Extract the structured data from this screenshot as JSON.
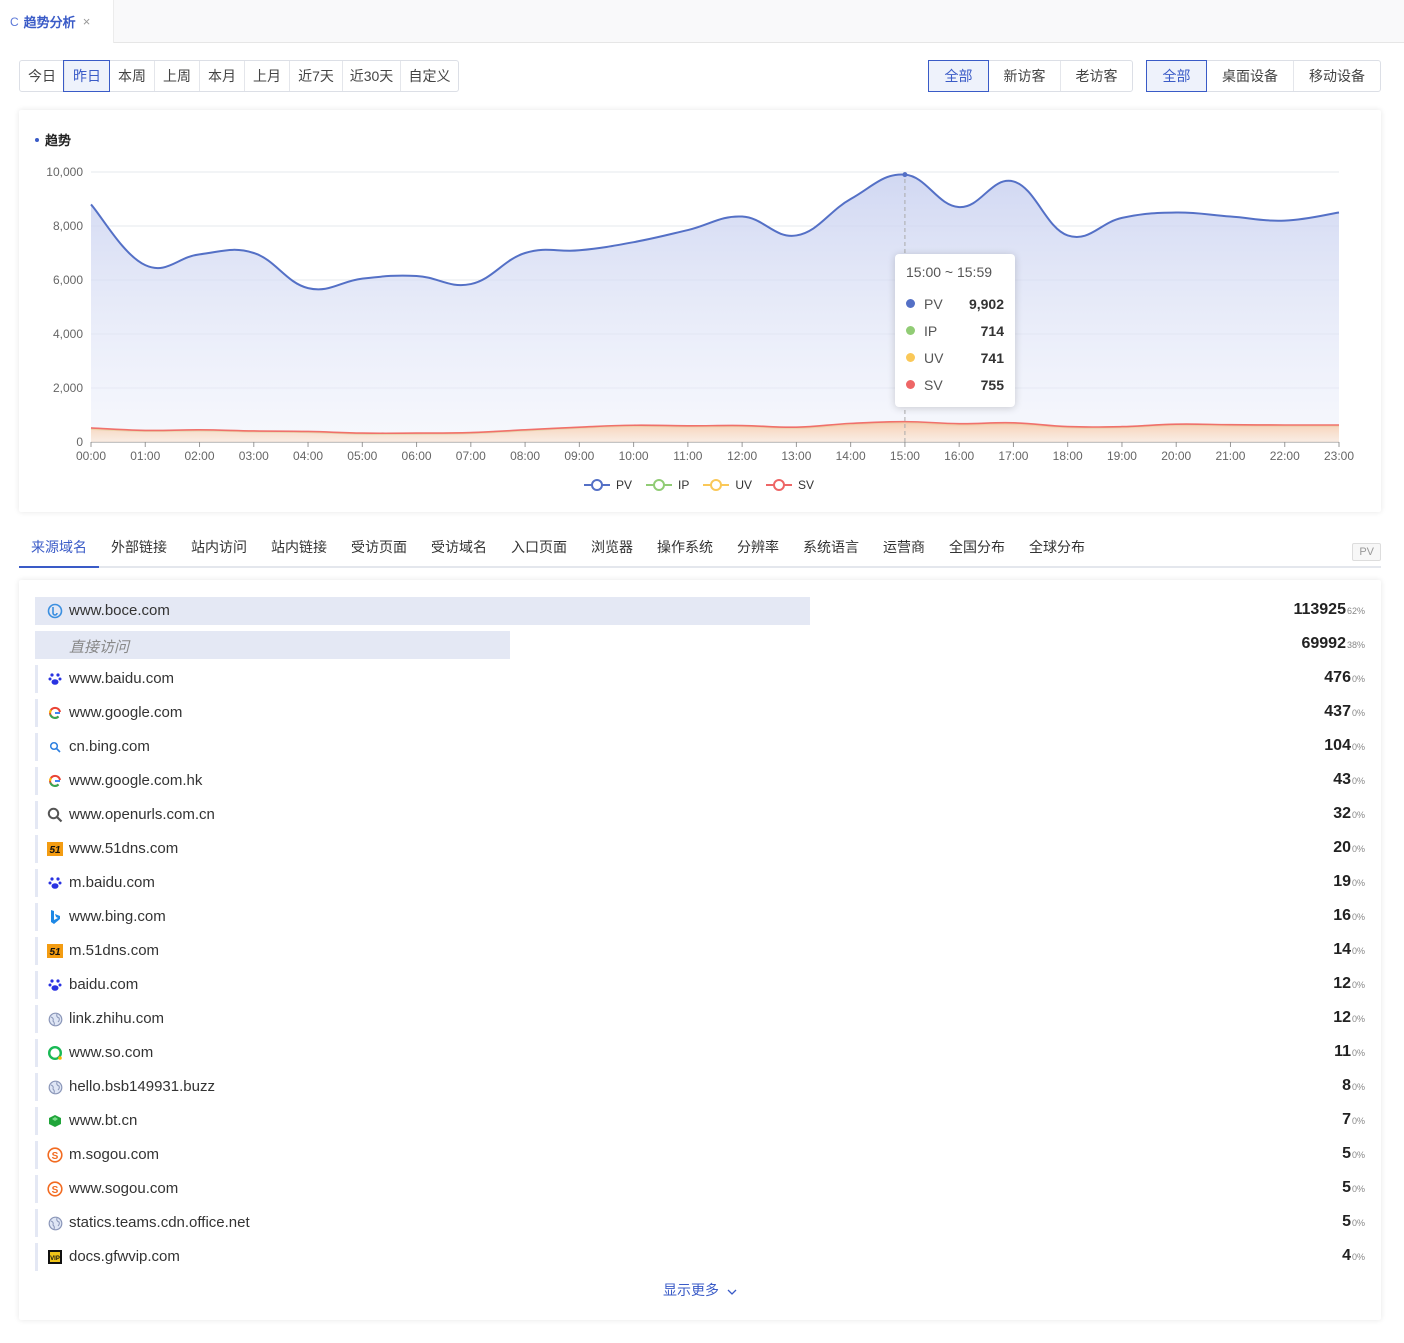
{
  "tab": {
    "title": "趋势分析",
    "reload_icon": "C",
    "close_icon": "×"
  },
  "date_range": {
    "options": [
      "今日",
      "昨日",
      "本周",
      "上周",
      "本月",
      "上月",
      "近7天",
      "近30天",
      "自定义"
    ],
    "selected": "昨日"
  },
  "visitor_filter": {
    "options": [
      "全部",
      "新访客",
      "老访客"
    ],
    "selected": "全部"
  },
  "device_filter": {
    "options": [
      "全部",
      "桌面设备",
      "移动设备"
    ],
    "selected": "全部"
  },
  "chart": {
    "title": "趋势"
  },
  "tooltip": {
    "title": "15:00 ~ 15:59",
    "rows": [
      {
        "name": "PV",
        "value": "9,902",
        "color": "#5470c6"
      },
      {
        "name": "IP",
        "value": "714",
        "color": "#91cc75"
      },
      {
        "name": "UV",
        "value": "741",
        "color": "#fac858"
      },
      {
        "name": "SV",
        "value": "755",
        "color": "#ee6666"
      }
    ]
  },
  "chart_data": {
    "type": "area",
    "title": "趋势",
    "categories": [
      "00:00",
      "01:00",
      "02:00",
      "03:00",
      "04:00",
      "05:00",
      "06:00",
      "07:00",
      "08:00",
      "09:00",
      "10:00",
      "11:00",
      "12:00",
      "13:00",
      "14:00",
      "15:00",
      "16:00",
      "17:00",
      "18:00",
      "19:00",
      "20:00",
      "21:00",
      "22:00",
      "23:00"
    ],
    "y_ticks": [
      "0",
      "2,000",
      "4,000",
      "6,000",
      "8,000",
      "10,000"
    ],
    "ylim": [
      0,
      10000
    ],
    "grid": true,
    "legend_position": "bottom",
    "series": [
      {
        "name": "PV",
        "color": "#5470c6",
        "values": [
          8800,
          6550,
          6950,
          7000,
          5700,
          6050,
          6150,
          5850,
          7000,
          7100,
          7400,
          7850,
          8350,
          7650,
          9000,
          9902,
          8700,
          9650,
          7650,
          8300,
          8500,
          8350,
          8200,
          8500
        ]
      },
      {
        "name": "IP",
        "color": "#91cc75",
        "values": [
          480,
          400,
          420,
          380,
          360,
          300,
          300,
          320,
          420,
          520,
          590,
          570,
          580,
          520,
          650,
          714,
          640,
          670,
          540,
          540,
          630,
          610,
          600,
          600
        ]
      },
      {
        "name": "UV",
        "color": "#fac858",
        "values": [
          500,
          420,
          440,
          400,
          380,
          320,
          320,
          340,
          440,
          540,
          610,
          590,
          600,
          540,
          670,
          741,
          660,
          690,
          560,
          560,
          650,
          630,
          620,
          620
        ]
      },
      {
        "name": "SV",
        "color": "#ee6666",
        "values": [
          520,
          430,
          450,
          410,
          390,
          330,
          330,
          350,
          450,
          550,
          620,
          600,
          610,
          550,
          690,
          755,
          680,
          710,
          570,
          570,
          660,
          640,
          630,
          630
        ]
      }
    ]
  },
  "source_tabs": {
    "items": [
      "来源域名",
      "外部链接",
      "站内访问",
      "站内链接",
      "受访页面",
      "受访域名",
      "入口页面",
      "浏览器",
      "操作系统",
      "分辨率",
      "系统语言",
      "运营商",
      "全国分布",
      "全球分布"
    ],
    "selected": "来源域名",
    "metric_tag": "PV"
  },
  "sources": [
    {
      "name": "www.boce.com",
      "count": "113925",
      "pct": "62%",
      "share": 0.62,
      "icon": "boce-icon",
      "italic": false
    },
    {
      "name": "直接访问",
      "count": "69992",
      "pct": "38%",
      "share": 0.38,
      "icon": "",
      "italic": true
    },
    {
      "name": "www.baidu.com",
      "count": "476",
      "pct": "0%",
      "share": 0,
      "icon": "baidu-icon",
      "italic": false
    },
    {
      "name": "www.google.com",
      "count": "437",
      "pct": "0%",
      "share": 0,
      "icon": "google-icon",
      "italic": false
    },
    {
      "name": "cn.bing.com",
      "count": "104",
      "pct": "0%",
      "share": 0,
      "icon": "search-icon",
      "italic": false
    },
    {
      "name": "www.google.com.hk",
      "count": "43",
      "pct": "0%",
      "share": 0,
      "icon": "google-icon",
      "italic": false
    },
    {
      "name": "www.openurls.com.cn",
      "count": "32",
      "pct": "0%",
      "share": 0,
      "icon": "magnifier-icon",
      "italic": false
    },
    {
      "name": "www.51dns.com",
      "count": "20",
      "pct": "0%",
      "share": 0,
      "icon": "51dns-icon",
      "italic": false
    },
    {
      "name": "m.baidu.com",
      "count": "19",
      "pct": "0%",
      "share": 0,
      "icon": "baidu-icon",
      "italic": false
    },
    {
      "name": "www.bing.com",
      "count": "16",
      "pct": "0%",
      "share": 0,
      "icon": "bing-icon",
      "italic": false
    },
    {
      "name": "m.51dns.com",
      "count": "14",
      "pct": "0%",
      "share": 0,
      "icon": "51dns-icon",
      "italic": false
    },
    {
      "name": "baidu.com",
      "count": "12",
      "pct": "0%",
      "share": 0,
      "icon": "baidu-icon",
      "italic": false
    },
    {
      "name": "link.zhihu.com",
      "count": "12",
      "pct": "0%",
      "share": 0,
      "icon": "globe-icon",
      "italic": false
    },
    {
      "name": "www.so.com",
      "count": "11",
      "pct": "0%",
      "share": 0,
      "icon": "so360-icon",
      "italic": false
    },
    {
      "name": "hello.bsb149931.buzz",
      "count": "8",
      "pct": "0%",
      "share": 0,
      "icon": "globe-icon",
      "italic": false
    },
    {
      "name": "www.bt.cn",
      "count": "7",
      "pct": "0%",
      "share": 0,
      "icon": "bt-icon",
      "italic": false
    },
    {
      "name": "m.sogou.com",
      "count": "5",
      "pct": "0%",
      "share": 0,
      "icon": "sogou-icon",
      "italic": false
    },
    {
      "name": "www.sogou.com",
      "count": "5",
      "pct": "0%",
      "share": 0,
      "icon": "sogou-icon",
      "italic": false
    },
    {
      "name": "statics.teams.cdn.office.net",
      "count": "5",
      "pct": "0%",
      "share": 0,
      "icon": "globe-icon",
      "italic": false
    },
    {
      "name": "docs.gfwvip.com",
      "count": "4",
      "pct": "0%",
      "share": 0,
      "icon": "vip-icon",
      "italic": false
    }
  ],
  "show_more": {
    "label": "显示更多",
    "icon": "chevron-down-icon"
  }
}
